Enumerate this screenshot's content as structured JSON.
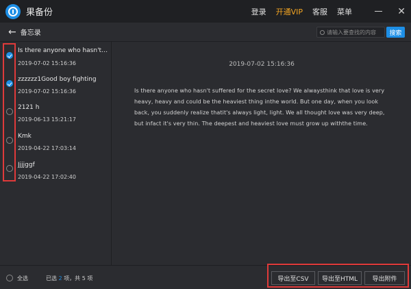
{
  "app": {
    "title": "果备份",
    "menu": {
      "login": "登录",
      "vip": "开通VIP",
      "service": "客服",
      "menu": "菜单"
    }
  },
  "subheader": {
    "title": "备忘录",
    "search_placeholder": "请输入要查找的内容",
    "search_label": "搜索"
  },
  "list": [
    {
      "title": "Is there anyone who hasn't su...",
      "time": "2019-07-02 15:16:36",
      "checked": true
    },
    {
      "title": "zzzzzz1Good boy fighting",
      "time": "2019-07-02 15:16:36",
      "checked": true
    },
    {
      "title": "2121 h",
      "time": "2019-06-13 15:21:17",
      "checked": false
    },
    {
      "title": "Kmk",
      "time": "2019-04-22 17:03:14",
      "checked": false
    },
    {
      "title": "Jjjjggf",
      "time": "2019-04-22 17:02:40",
      "checked": false
    }
  ],
  "detail": {
    "time": "2019-07-02 15:16:36",
    "body": "Is there anyone who hasn't suffered for the secret love? We alwaysthink that love is very heavy, heavy and could be the heaviest thing inthe world. But one day, when you look back, you suddenly realize thatit's always light, light. We all thought love was very deep, but infact it's very thin. The deepest and heaviest love must grow up withthe time."
  },
  "footer": {
    "select_all": "全选",
    "count_prefix": "已选",
    "count_selected": "2",
    "count_suffix": "项，共 5 项",
    "export_csv": "导出至CSV",
    "export_html": "导出至HTML",
    "export_attach": "导出附件"
  },
  "colors": {
    "accent": "#1e8fe6",
    "vip": "#f5a623",
    "highlight": "#e03a3a"
  }
}
